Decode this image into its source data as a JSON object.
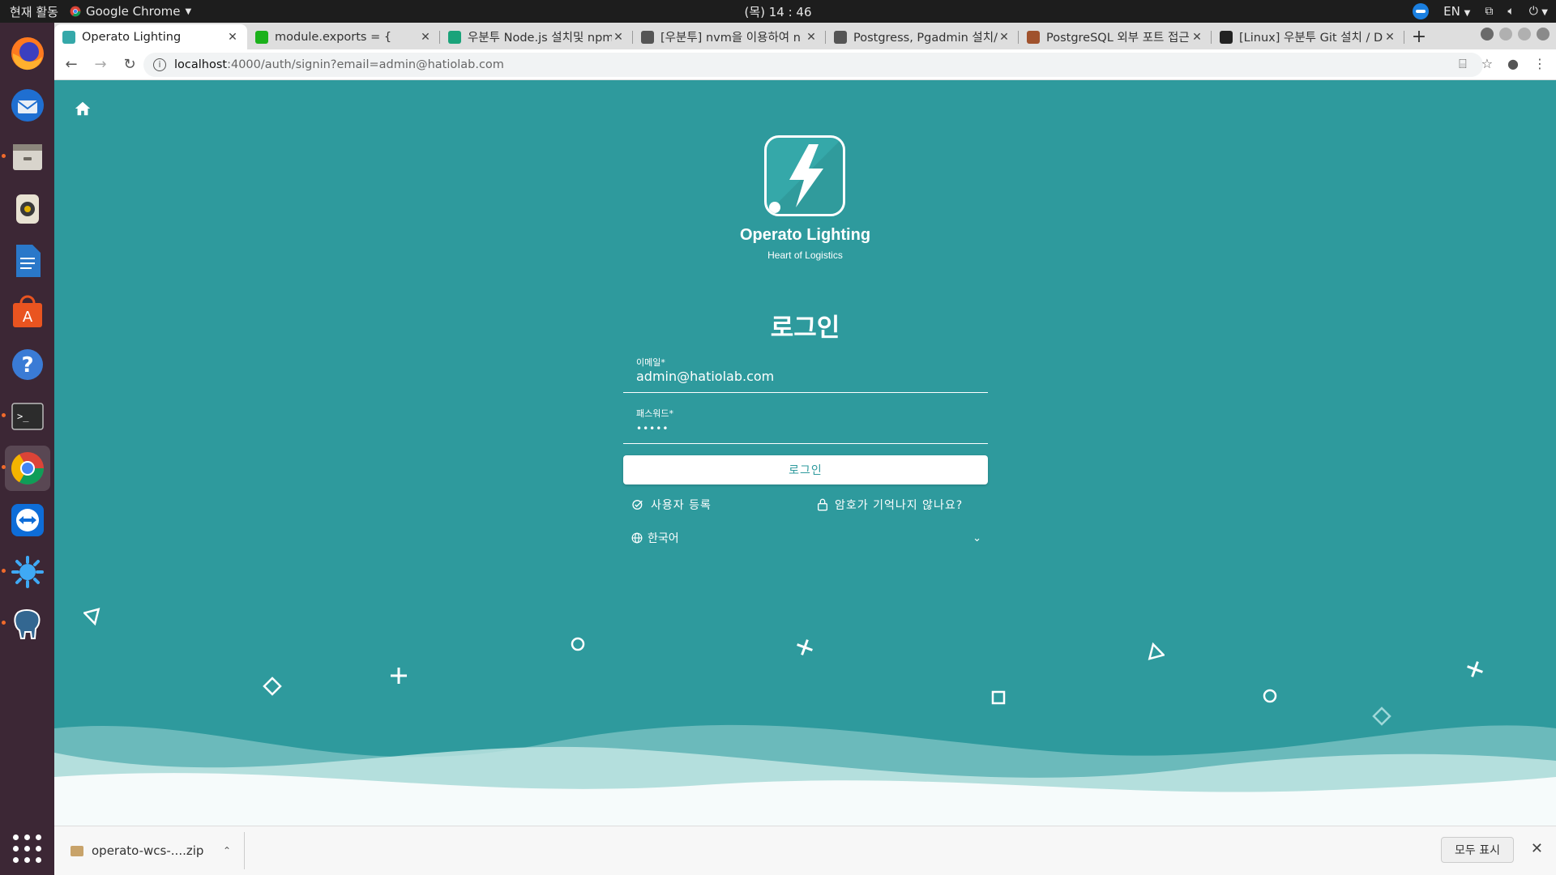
{
  "top_panel": {
    "activities": "현재 활동",
    "app_name": "Google Chrome",
    "clock": "(목) 14 : 46",
    "lang": "EN"
  },
  "dock": {
    "items": [
      "firefox",
      "thunderbird",
      "files",
      "rhythmbox",
      "writer",
      "software",
      "help",
      "terminal",
      "chrome",
      "teamviewer",
      "splash-app",
      "pgadmin"
    ]
  },
  "browser": {
    "tabs": [
      {
        "title": "Operato Lighting",
        "color": "#35a8a9"
      },
      {
        "title": "module.exports = {",
        "color": "#1bb11b"
      },
      {
        "title": "우분투 Node.js 설치및 npm",
        "color": "#1aa37a"
      },
      {
        "title": "[우분투] nvm을 이용하여 n",
        "color": "#555555"
      },
      {
        "title": "Postgress, Pgadmin 설치/",
        "color": "#555555"
      },
      {
        "title": "PostgreSQL 외부 포트 접근",
        "color": "#a0522d"
      },
      {
        "title": "[Linux] 우분투 Git 설치 / D",
        "color": "#222222"
      }
    ],
    "url_host": "localhost",
    "url_path": ":4000/auth/signin?email=admin@hatiolab.com"
  },
  "page": {
    "brand_name": "Operato Lighting",
    "brand_sub": "Heart of Logistics",
    "login_title": "로그인",
    "email_label": "이메일*",
    "email_value": "admin@hatiolab.com",
    "password_label": "패스워드*",
    "password_value": "•••••",
    "login_button": "로그인",
    "register_link": "사용자 등록",
    "forgot_link": "암호가 기억나지 않나요?",
    "language": "한국어"
  },
  "downloads": {
    "file": "operato-wcs-....zip",
    "show_all": "모두 표시"
  }
}
